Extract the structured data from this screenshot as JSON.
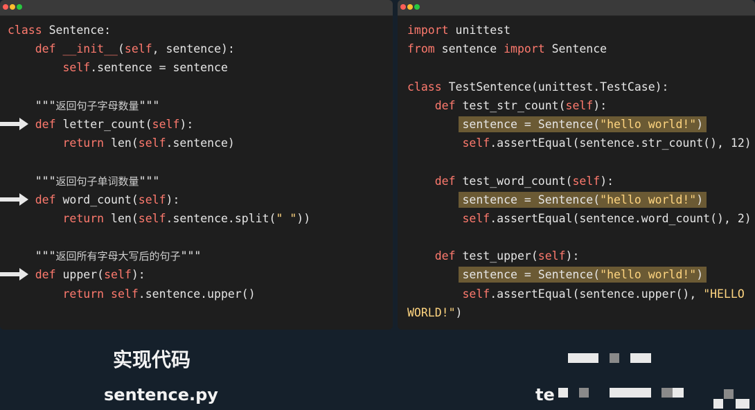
{
  "left_window": {
    "lines": [
      [
        {
          "t": "class ",
          "c": "kw"
        },
        {
          "t": "Sentence:"
        }
      ],
      [
        {
          "t": "    "
        },
        {
          "t": "def ",
          "c": "kw"
        },
        {
          "t": "__init__",
          "c": "kw"
        },
        {
          "t": "("
        },
        {
          "t": "self",
          "c": "self"
        },
        {
          "t": ", sentence):"
        }
      ],
      [
        {
          "t": "        "
        },
        {
          "t": "self",
          "c": "self"
        },
        {
          "t": ".sentence = sentence"
        }
      ],
      [],
      [
        {
          "t": "    \"\"\""
        },
        {
          "t": "返回句子字母数量",
          "c": "cmt"
        },
        {
          "t": "\"\"\""
        }
      ],
      [
        {
          "t": "    "
        },
        {
          "t": "def ",
          "c": "kw"
        },
        {
          "t": "letter_count("
        },
        {
          "t": "self",
          "c": "self"
        },
        {
          "t": "):"
        }
      ],
      [
        {
          "t": "        "
        },
        {
          "t": "return ",
          "c": "kw"
        },
        {
          "t": "len("
        },
        {
          "t": "self",
          "c": "self"
        },
        {
          "t": ".sentence)"
        }
      ],
      [],
      [
        {
          "t": "    \"\"\""
        },
        {
          "t": "返回句子单词数量",
          "c": "cmt"
        },
        {
          "t": "\"\"\""
        }
      ],
      [
        {
          "t": "    "
        },
        {
          "t": "def ",
          "c": "kw"
        },
        {
          "t": "word_count("
        },
        {
          "t": "self",
          "c": "self"
        },
        {
          "t": "):"
        }
      ],
      [
        {
          "t": "        "
        },
        {
          "t": "return ",
          "c": "kw"
        },
        {
          "t": "len("
        },
        {
          "t": "self",
          "c": "self"
        },
        {
          "t": ".sentence.split("
        },
        {
          "t": "\" \"",
          "c": "str"
        },
        {
          "t": "))"
        }
      ],
      [],
      [
        {
          "t": "    \"\"\""
        },
        {
          "t": "返回所有字母大写后的句子",
          "c": "cmt"
        },
        {
          "t": "\"\"\""
        }
      ],
      [
        {
          "t": "    "
        },
        {
          "t": "def ",
          "c": "kw"
        },
        {
          "t": "upper("
        },
        {
          "t": "self",
          "c": "self"
        },
        {
          "t": "):"
        }
      ],
      [
        {
          "t": "        "
        },
        {
          "t": "return ",
          "c": "kw"
        },
        {
          "t": "self",
          "c": "self"
        },
        {
          "t": ".sentence.upper()"
        }
      ]
    ],
    "arrow_lines": [
      5,
      9,
      13
    ]
  },
  "right_window": {
    "lines": [
      [
        {
          "t": "import ",
          "c": "kw"
        },
        {
          "t": "unittest"
        }
      ],
      [
        {
          "t": "from ",
          "c": "kw"
        },
        {
          "t": "sentence "
        },
        {
          "t": "import ",
          "c": "kw"
        },
        {
          "t": "Sentence"
        }
      ],
      [],
      [
        {
          "t": "class ",
          "c": "kw"
        },
        {
          "t": "TestSentence(unittest.TestCase):"
        }
      ],
      [
        {
          "t": "    "
        },
        {
          "t": "def ",
          "c": "kw"
        },
        {
          "t": "test_str_count("
        },
        {
          "t": "self",
          "c": "self"
        },
        {
          "t": "):"
        }
      ],
      [
        {
          "t": "        "
        },
        {
          "hl": true,
          "parts": [
            {
              "t": "sentence = Sentence("
            },
            {
              "t": "\"hello world!\"",
              "c": "str"
            },
            {
              "t": ")"
            }
          ]
        }
      ],
      [
        {
          "t": "        "
        },
        {
          "t": "self",
          "c": "self"
        },
        {
          "t": ".assertEqual(sentence.str_count(), 12)"
        }
      ],
      [],
      [
        {
          "t": "    "
        },
        {
          "t": "def ",
          "c": "kw"
        },
        {
          "t": "test_word_count("
        },
        {
          "t": "self",
          "c": "self"
        },
        {
          "t": "):"
        }
      ],
      [
        {
          "t": "        "
        },
        {
          "hl": true,
          "parts": [
            {
              "t": "sentence = Sentence("
            },
            {
              "t": "\"hello world!\"",
              "c": "str"
            },
            {
              "t": ")"
            }
          ]
        }
      ],
      [
        {
          "t": "        "
        },
        {
          "t": "self",
          "c": "self"
        },
        {
          "t": ".assertEqual(sentence.word_count(), 2)"
        }
      ],
      [],
      [
        {
          "t": "    "
        },
        {
          "t": "def ",
          "c": "kw"
        },
        {
          "t": "test_upper("
        },
        {
          "t": "self",
          "c": "self"
        },
        {
          "t": "):"
        }
      ],
      [
        {
          "t": "        "
        },
        {
          "hl": true,
          "parts": [
            {
              "t": "sentence = Sentence("
            },
            {
              "t": "\"hello world!\"",
              "c": "str"
            },
            {
              "t": ")"
            }
          ]
        }
      ],
      [
        {
          "t": "        "
        },
        {
          "t": "self",
          "c": "self"
        },
        {
          "t": ".assertEqual(sentence.upper(), "
        },
        {
          "t": "\"HELLO",
          "c": "str"
        }
      ],
      [
        {
          "t": "WORLD!\"",
          "c": "str"
        },
        {
          "t": ")"
        }
      ]
    ]
  },
  "captions": {
    "title": "实现代码",
    "left_file": "sentence.py",
    "right_file_partial": "te"
  },
  "colors": {
    "keyword": "#ff7a6e",
    "string": "#ffd580",
    "highlight": "#6b5a34",
    "arrow": "#e8e8e8"
  }
}
